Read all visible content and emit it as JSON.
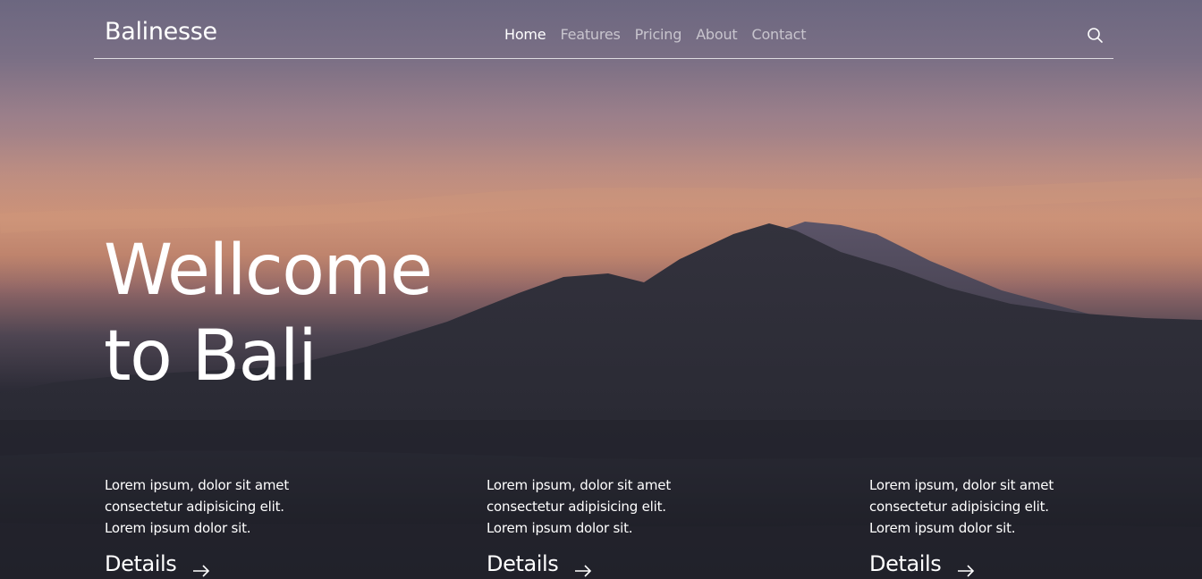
{
  "brand": "Balinesse",
  "nav": {
    "items": [
      {
        "label": "Home",
        "active": true
      },
      {
        "label": "Features",
        "active": false
      },
      {
        "label": "Pricing",
        "active": false
      },
      {
        "label": "About",
        "active": false
      },
      {
        "label": "Contact",
        "active": false
      }
    ],
    "search_icon": "search-icon"
  },
  "hero": {
    "title_line1": "Wellcome",
    "title_line2": "to Bali"
  },
  "features": [
    {
      "lines": [
        "Lorem ipsum, dolor sit amet",
        "consectetur adipisicing elit.",
        "Lorem ipsum dolor sit."
      ],
      "link_label": "Details",
      "link_icon": "arrow-right-icon"
    },
    {
      "lines": [
        "Lorem ipsum, dolor sit amet",
        "consectetur adipisicing elit.",
        "Lorem ipsum dolor sit."
      ],
      "link_label": "Details",
      "link_icon": "arrow-right-icon"
    },
    {
      "lines": [
        "Lorem ipsum, dolor sit amet",
        "consectetur adipisicing elit.",
        "Lorem ipsum dolor sit."
      ],
      "link_label": "Details",
      "link_icon": "arrow-right-icon"
    }
  ],
  "colors": {
    "text": "#ffffff",
    "nav_inactive": "#ffffff99",
    "sky_top": "#6c6780",
    "sky_glow": "#c08e7c",
    "mountain": "#2c2c37"
  }
}
